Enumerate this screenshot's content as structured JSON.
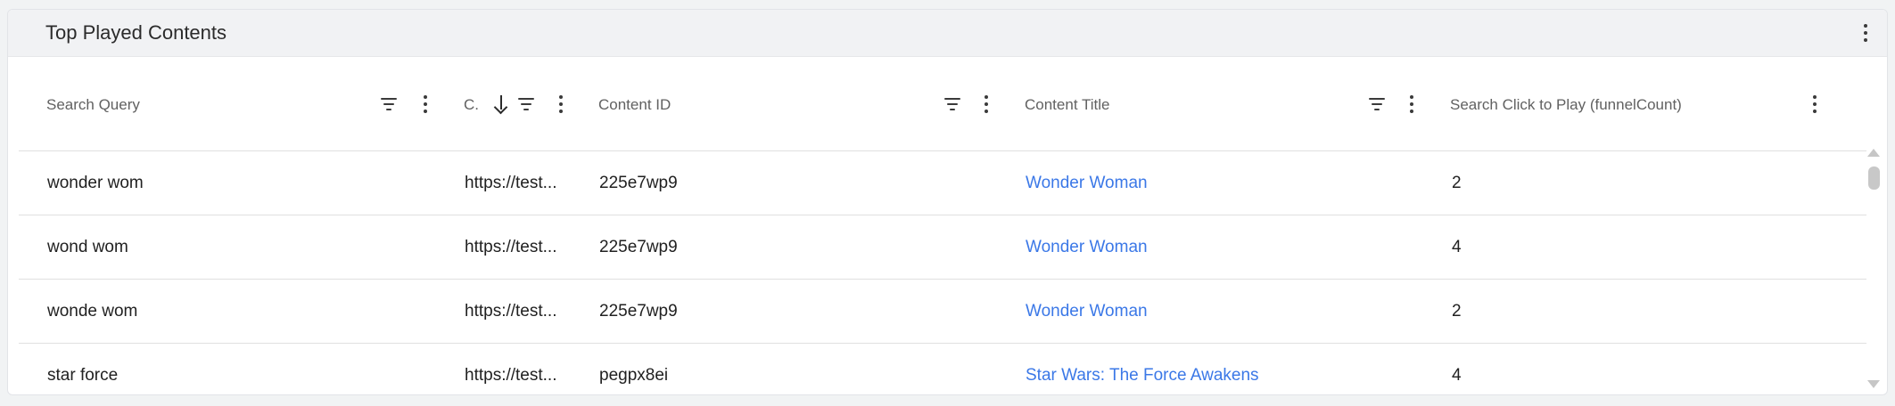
{
  "widget": {
    "title": "Top Played Contents"
  },
  "columns": [
    {
      "label": "Search Query"
    },
    {
      "label": "C."
    },
    {
      "label": "Content ID"
    },
    {
      "label": "Content Title"
    },
    {
      "label": "Search Click to Play (funnelCount)"
    }
  ],
  "rows": [
    {
      "query": "wonder wom",
      "url": "https://test...",
      "content_id": "225e7wp9",
      "title": "Wonder Woman",
      "count": "2"
    },
    {
      "query": "wond wom",
      "url": "https://test...",
      "content_id": "225e7wp9",
      "title": "Wonder Woman",
      "count": "4"
    },
    {
      "query": "wonde wom",
      "url": "https://test...",
      "content_id": "225e7wp9",
      "title": "Wonder Woman",
      "count": "2"
    },
    {
      "query": "star force",
      "url": "https://test...",
      "content_id": "pegpx8ei",
      "title": "Star Wars: The Force Awakens",
      "count": "4"
    }
  ],
  "icons": {
    "filter": "filter-icon",
    "menu": "more-vert-icon",
    "sort": "arrow-down-icon"
  }
}
